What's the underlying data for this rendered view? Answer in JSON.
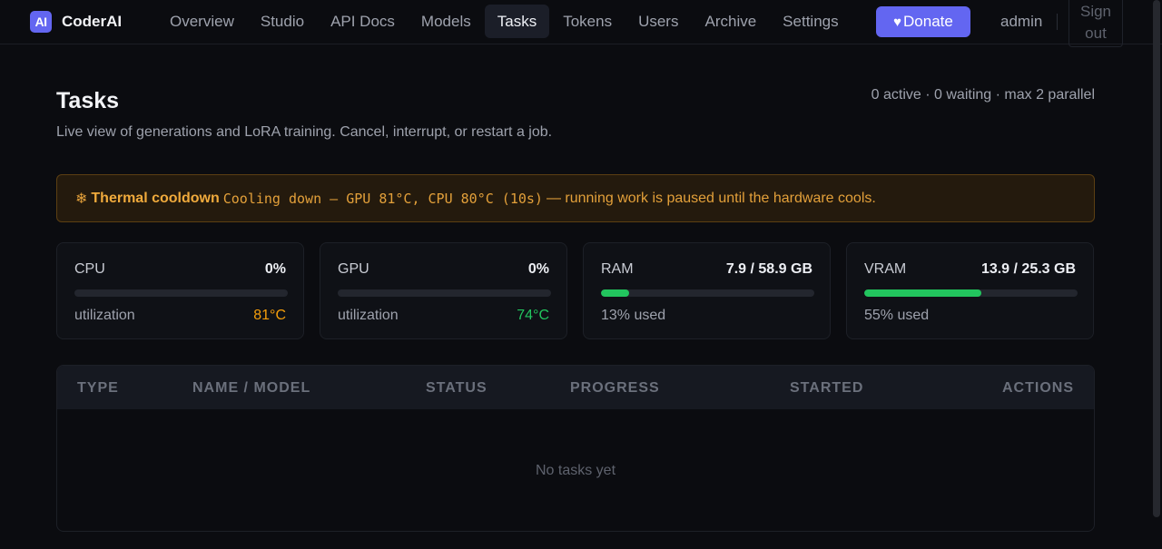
{
  "app": {
    "logo_text": "AI",
    "name": "CoderAI"
  },
  "nav": {
    "items": [
      {
        "label": "Overview",
        "active": false
      },
      {
        "label": "Studio",
        "active": false
      },
      {
        "label": "API Docs",
        "active": false
      },
      {
        "label": "Models",
        "active": false
      },
      {
        "label": "Tasks",
        "active": true
      },
      {
        "label": "Tokens",
        "active": false
      },
      {
        "label": "Users",
        "active": false
      },
      {
        "label": "Archive",
        "active": false
      },
      {
        "label": "Settings",
        "active": false
      }
    ],
    "donate_icon": "♥",
    "donate_label": "Donate",
    "user": "admin",
    "signout_label": "Sign out"
  },
  "page": {
    "title": "Tasks",
    "subtitle": "Live view of generations and LoRA training. Cancel, interrupt, or restart a job.",
    "queue_stats": "0 active · 0 waiting · max 2 parallel"
  },
  "alert": {
    "icon": "❄",
    "icon_name": "snowflake-icon",
    "title": "Thermal cooldown",
    "detail": "Cooling down — GPU 81°C, CPU 80°C (10s)",
    "message": "— running work is paused until the hardware cools."
  },
  "stats": {
    "cpu": {
      "label": "CPU",
      "value": "0%",
      "fill": 0.0,
      "foot": "utilization",
      "temp": "81°C",
      "temp_color": "#f59e0b"
    },
    "gpu": {
      "label": "GPU",
      "value": "0%",
      "fill": 0.0,
      "foot": "utilization",
      "temp": "74°C",
      "temp_color": "#22c55e"
    },
    "ram": {
      "label": "RAM",
      "value": "7.9 / 58.9 GB",
      "fill": 0.134,
      "foot": "13% used"
    },
    "vram": {
      "label": "VRAM",
      "value": "13.9 / 25.3 GB",
      "fill": 0.55,
      "foot": "55% used"
    }
  },
  "table": {
    "columns": [
      "TYPE",
      "NAME / MODEL",
      "STATUS",
      "PROGRESS",
      "STARTED",
      "ACTIONS"
    ],
    "empty_text": "No tasks yet"
  },
  "colors": {
    "accent": "#6366f1",
    "ok": "#22c55e",
    "warn": "#f59e0b"
  }
}
